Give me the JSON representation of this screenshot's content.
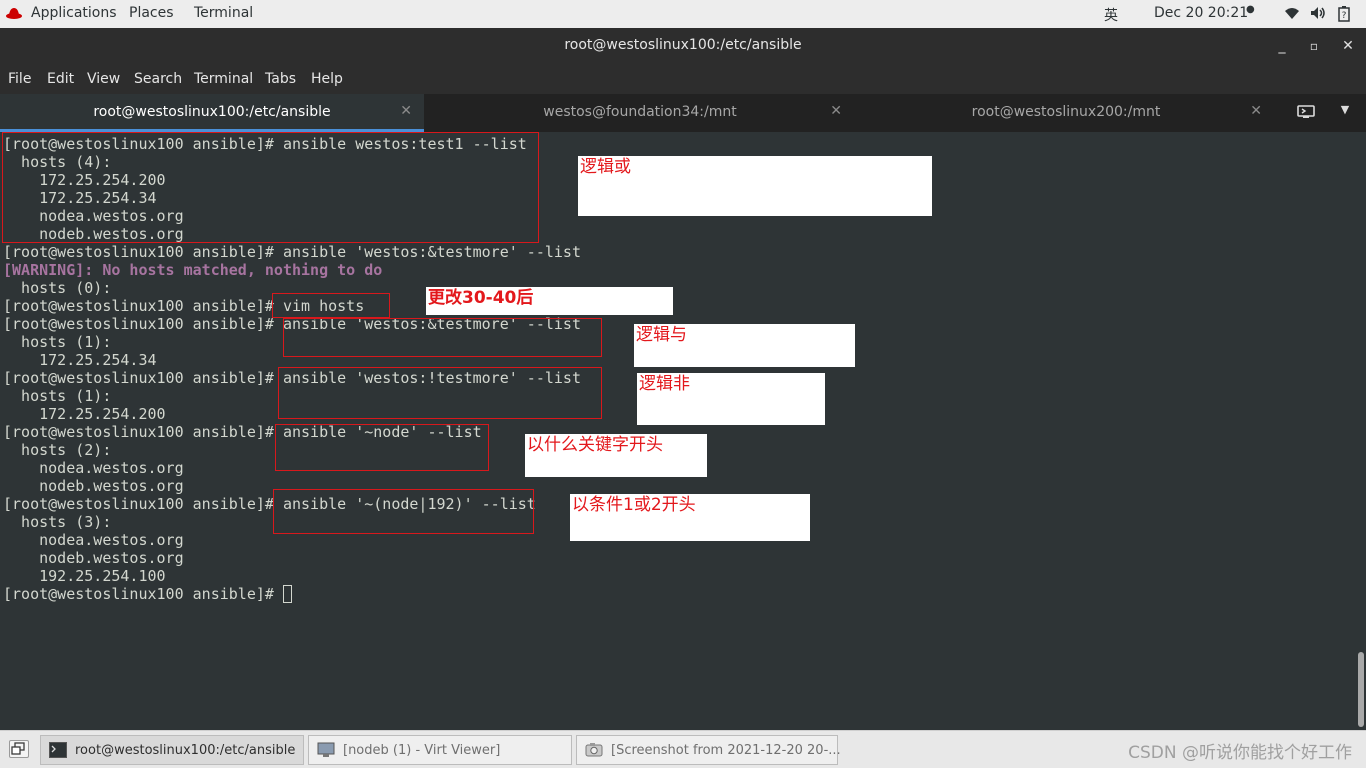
{
  "topbar": {
    "applications": "Applications",
    "places": "Places",
    "terminal": "Terminal",
    "input_method": "英",
    "datetime": "Dec 20  20:21"
  },
  "window": {
    "title": "root@westoslinux100:/etc/ansible",
    "minimize": "_",
    "maximize": "▫",
    "close": "✕"
  },
  "menu": [
    "File",
    "Edit",
    "View",
    "Search",
    "Terminal",
    "Tabs",
    "Help"
  ],
  "tabs": [
    {
      "label": "root@westoslinux100:/etc/ansible",
      "active": true
    },
    {
      "label": "westos@foundation34:/mnt",
      "active": false
    },
    {
      "label": "root@westoslinux200:/mnt",
      "active": false
    }
  ],
  "terminal": {
    "lines": [
      "[root@westoslinux100 ansible]# ansible westos:test1 --list",
      "  hosts (4):",
      "    172.25.254.200",
      "    172.25.254.34",
      "    nodea.westos.org",
      "    nodeb.westos.org",
      "[root@westoslinux100 ansible]# ansible 'westos:&testmore' --list",
      "[WARNING]: No hosts matched, nothing to do",
      "  hosts (0):",
      "[root@westoslinux100 ansible]# vim hosts",
      "[root@westoslinux100 ansible]# ansible 'westos:&testmore' --list",
      "  hosts (1):",
      "    172.25.254.34",
      "[root@westoslinux100 ansible]# ansible 'westos:!testmore' --list",
      "  hosts (1):",
      "    172.25.254.200",
      "[root@westoslinux100 ansible]# ansible '~node' --list",
      "  hosts (2):",
      "    nodea.westos.org",
      "    nodeb.westos.org",
      "[root@westoslinux100 ansible]# ansible '~(node|192)' --list",
      "  hosts (3):",
      "    nodea.westos.org",
      "    nodeb.westos.org",
      "    192.25.254.100",
      "[root@westoslinux100 ansible]# "
    ]
  },
  "annotations": [
    "逻辑或",
    "更改30-40后",
    "逻辑与",
    "逻辑非",
    "以什么关键字开头",
    "以条件1或2开头"
  ],
  "taskbar": {
    "items": [
      {
        "label": "root@westoslinux100:/etc/ansible",
        "icon": "terminal-icon"
      },
      {
        "label": "[nodeb (1) - Virt Viewer]",
        "icon": "monitor-icon"
      },
      {
        "label": "[Screenshot from 2021-12-20 20-...",
        "icon": "screenshot-icon"
      }
    ],
    "watermark": "CSDN @听说你能找个好工作"
  },
  "colors": {
    "terminal_bg": "#2e3436",
    "terminal_fg": "#d3d7cf",
    "warning": "#a774a0",
    "annotation_red": "#e3181c",
    "tab_accent": "#4a90d9"
  }
}
